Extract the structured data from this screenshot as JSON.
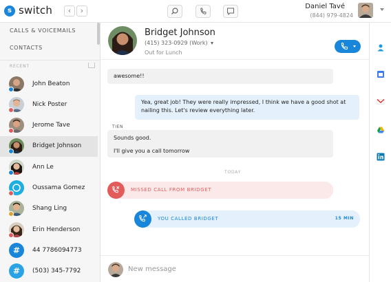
{
  "app": {
    "brand": "switch",
    "logo_letter": "s"
  },
  "topbar": {
    "nav_back": "‹",
    "nav_forward": "›",
    "user_name": "Daniel Tavé",
    "user_phone": "(844) 979-4824"
  },
  "sidebar": {
    "nav": [
      "CALLS & VOICEMAILS",
      "CONTACTS"
    ],
    "recent_label": "RECENT",
    "contacts": [
      {
        "name": "John Beaton",
        "badge_color": "#1a86d9"
      },
      {
        "name": "Nick Poster",
        "badge_color": "#e05a5a"
      },
      {
        "name": "Jerome Tave",
        "badge_color": "#e05a5a"
      },
      {
        "name": "Bridget Johnson",
        "badge_color": "#1a86d9",
        "active": true
      },
      {
        "name": "Ann Le",
        "badge_color": "#1a86d9"
      },
      {
        "name": "Oussama Gomez",
        "badge_color": "#e05a5a",
        "icon": "circle"
      },
      {
        "name": "Shang Ling",
        "badge_color": "#e0a030"
      },
      {
        "name": "Erin Henderson",
        "badge_color": "#e05a5a"
      },
      {
        "name": "44 7786094773",
        "icon": "#"
      },
      {
        "name": "(503) 345-7792",
        "icon": "#"
      }
    ]
  },
  "conversation": {
    "name": "Bridget Johnson",
    "phone": "(415) 323-0929 (Work)",
    "status": "Out for Lunch",
    "messages": {
      "m1": "awesome!!",
      "m2": "Yea, great job! They were really impressed, I think we have a good shot at nailing this. Let's review everything later.",
      "sender": "TIEN",
      "m3": "Sounds good.",
      "m4": "I'll give you a call tomorrow"
    },
    "day_label": "TODAY",
    "missed_call": "MISSED CALL FROM BRIDGET",
    "outgoing_call": "YOU CALLED BRIDGET",
    "outgoing_duration": "15 MIN"
  },
  "composer": {
    "placeholder": "New message"
  },
  "colors": {
    "accent": "#1a86d9",
    "missed": "#e25c5c",
    "missed_bg": "#fbe8e8",
    "outgoing_bg": "#e4f0fb"
  },
  "rightbar_icons": [
    "contact-icon",
    "calendar-icon",
    "gmail-icon",
    "google-drive-icon",
    "linkedin-icon"
  ]
}
